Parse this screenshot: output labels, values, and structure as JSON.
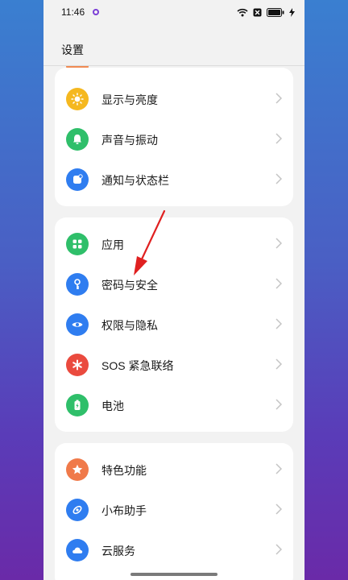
{
  "status_bar": {
    "time": "11:46"
  },
  "header": {
    "title": "设置"
  },
  "groups": [
    {
      "items": [
        {
          "label": "显示与亮度"
        },
        {
          "label": "声音与振动"
        },
        {
          "label": "通知与状态栏"
        }
      ]
    },
    {
      "items": [
        {
          "label": "应用"
        },
        {
          "label": "密码与安全"
        },
        {
          "label": "权限与隐私"
        },
        {
          "label": "SOS 紧急联络"
        },
        {
          "label": "电池"
        }
      ]
    },
    {
      "items": [
        {
          "label": "特色功能"
        },
        {
          "label": "小布助手"
        },
        {
          "label": "云服务"
        }
      ]
    }
  ],
  "colors": {
    "display_icon": "#f5b820",
    "sound_icon": "#2fbf6a",
    "notify_icon": "#2f7df0",
    "apps_icon": "#2fbf6a",
    "password_icon": "#2f7df0",
    "privacy_icon": "#2f7df0",
    "sos_icon": "#ea4a3e",
    "battery_icon": "#2fbf6a",
    "features_icon": "#f07a4a",
    "assistant_icon": "#2f7df0",
    "cloud_icon": "#2f7df0",
    "arrow": "#e02020"
  }
}
